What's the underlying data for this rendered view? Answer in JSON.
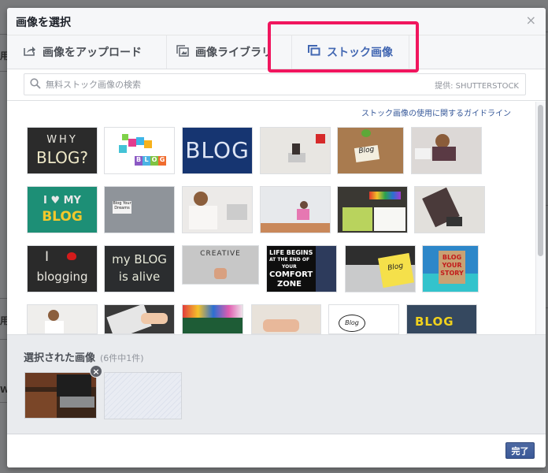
{
  "dialog": {
    "title": "画像を選択",
    "close_label": "×"
  },
  "tabs": [
    {
      "label": "画像をアップロード",
      "icon": "upload-icon",
      "active": false
    },
    {
      "label": "画像ライブラリ",
      "icon": "image-library-icon",
      "active": false
    },
    {
      "label": "ストック画像",
      "icon": "stock-images-icon",
      "active": true
    }
  ],
  "search": {
    "placeholder": "無料ストック画像の検索",
    "value": "",
    "provider": "提供: SHUTTERSTOCK"
  },
  "guideline_link": "ストック画像の使用に関するガイドライン",
  "images": [
    {
      "alt": "WHY BLOG? chalkboard",
      "row": 0,
      "col": 0
    },
    {
      "alt": "Colorful BLOG blocks",
      "row": 0,
      "col": 1
    },
    {
      "alt": "BLOG on blue chalkboard",
      "row": 0,
      "col": 2
    },
    {
      "alt": "Person with laptop in room",
      "row": 0,
      "col": 3
    },
    {
      "alt": "Blog notebook on desk",
      "row": 0,
      "col": 4
    },
    {
      "alt": "Woman with headphones and laptop",
      "row": 0,
      "col": 5
    },
    {
      "alt": "I love MY BLOG",
      "row": 1,
      "col": 0
    },
    {
      "alt": "Blog Your Dreams card",
      "row": 1,
      "col": 1
    },
    {
      "alt": "Woman writing at desk",
      "row": 1,
      "col": 2
    },
    {
      "alt": "Woman sitting with laptop",
      "row": 1,
      "col": 3
    },
    {
      "alt": "Blog painting with colors",
      "row": 1,
      "col": 4
    },
    {
      "alt": "Woman lying with laptop top view",
      "row": 1,
      "col": 5
    },
    {
      "alt": "I love blogging chalkboard",
      "row": 2,
      "col": 0
    },
    {
      "alt": "my BLOG is alive",
      "row": 2,
      "col": 1
    },
    {
      "alt": "Creative blog sketch",
      "row": 2,
      "col": 2
    },
    {
      "alt": "LIFE BEGINS AT THE END OF YOUR COMFORT ZONE",
      "row": 2,
      "col": 3
    },
    {
      "alt": "Blog sticky note on laptop",
      "row": 2,
      "col": 4
    },
    {
      "alt": "BLOG YOUR STORY sign",
      "row": 2,
      "col": 5
    },
    {
      "alt": "Fashion blogger",
      "row": 3,
      "col": 0
    },
    {
      "alt": "Typing on laptop",
      "row": 3,
      "col": 1
    },
    {
      "alt": "Colorful BLOG art",
      "row": 3,
      "col": 2
    },
    {
      "alt": "Hands on laptop",
      "row": 3,
      "col": 3
    },
    {
      "alt": "Blog hand drawn",
      "row": 3,
      "col": 4
    },
    {
      "alt": "BLOG in jeans pocket",
      "row": 3,
      "col": 5
    }
  ],
  "thumb_text": {
    "why_blog_1": "WHY",
    "why_blog_2": "BLOG?",
    "blog_blue": "BLOG",
    "blocks": "BLOG",
    "blog_note": "Blog",
    "i_love": "I ♥ MY",
    "my_blog": "BLOG",
    "blog_dreams": "Blog Your Dreams",
    "i_blogging_1": "I",
    "i_blogging_2": "blogging",
    "alive_1": "my BLOG",
    "alive_2": "is alive",
    "creative": "CREATIVE",
    "comfort_1": "LIFE BEGINS",
    "comfort_2": "AT THE END OF",
    "comfort_3": "YOUR",
    "comfort_4": "COMFORT",
    "comfort_5": "ZONE",
    "sticky": "Blog",
    "story_1": "BLOG",
    "story_2": "YOUR",
    "story_3": "STORY",
    "hand_blog": "Blog",
    "jeans": "BLOG"
  },
  "selected": {
    "title": "選択された画像",
    "count": "(6件中1件)",
    "remove_label": "×"
  },
  "footer": {
    "done_label": "完了"
  },
  "background": {
    "chars": [
      "用",
      "用",
      "W"
    ]
  }
}
